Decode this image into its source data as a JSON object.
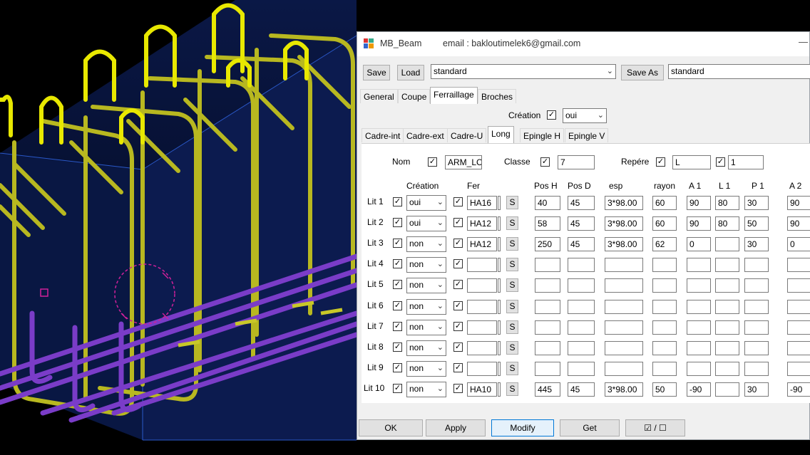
{
  "window": {
    "title": "MB_Beam",
    "email": "email :  bakloutimelek6@gmail.com",
    "minimize_glyph": "—"
  },
  "toolbar": {
    "save_label": "Save",
    "load_label": "Load",
    "preset_value": "standard",
    "save_as_label": "Save As",
    "save_as_value": "standard"
  },
  "main_tabs": [
    "General",
    "Coupe",
    "Ferraillage",
    "Broches"
  ],
  "creation": {
    "label": "Création",
    "checked": true,
    "value": "oui"
  },
  "sub_tabs": [
    "Cadre-int",
    "Cadre-ext",
    "Cadre-U",
    "Long",
    "Epingle H",
    "Epingle V"
  ],
  "header_fields": {
    "nom_label": "Nom",
    "nom_value": "ARM_LC",
    "classe_label": "Classe",
    "classe_value": "7",
    "repere_label": "Repére",
    "repere_value": "L",
    "repere2_value": "1"
  },
  "columns": {
    "creation": "Création",
    "fer": "Fer",
    "pos_h": "Pos H",
    "pos_d": "Pos D",
    "esp": "esp",
    "rayon": "rayon",
    "a1": "A 1",
    "l1": "L 1",
    "p1": "P 1",
    "a2": "A 2"
  },
  "rows": [
    {
      "label": "Lit 1",
      "creation": "oui",
      "fer": "HA16",
      "pos_h": "40",
      "pos_d": "45",
      "esp": "3*98.00",
      "rayon": "60",
      "a1": "90",
      "l1": "80",
      "p1": "30",
      "a2": "90"
    },
    {
      "label": "Lit 2",
      "creation": "oui",
      "fer": "HA12",
      "pos_h": "58",
      "pos_d": "45",
      "esp": "3*98.00",
      "rayon": "60",
      "a1": "90",
      "l1": "80",
      "p1": "50",
      "a2": "90"
    },
    {
      "label": "Lit 3",
      "creation": "non",
      "fer": "HA12",
      "pos_h": "250",
      "pos_d": "45",
      "esp": "3*98.00",
      "rayon": "62",
      "a1": "0",
      "l1": "",
      "p1": "30",
      "a2": "0"
    },
    {
      "label": "Lit 4",
      "creation": "non",
      "fer": "",
      "pos_h": "",
      "pos_d": "",
      "esp": "",
      "rayon": "",
      "a1": "",
      "l1": "",
      "p1": "",
      "a2": ""
    },
    {
      "label": "Lit 5",
      "creation": "non",
      "fer": "",
      "pos_h": "",
      "pos_d": "",
      "esp": "",
      "rayon": "",
      "a1": "",
      "l1": "",
      "p1": "",
      "a2": ""
    },
    {
      "label": "Lit 6",
      "creation": "non",
      "fer": "",
      "pos_h": "",
      "pos_d": "",
      "esp": "",
      "rayon": "",
      "a1": "",
      "l1": "",
      "p1": "",
      "a2": ""
    },
    {
      "label": "Lit 7",
      "creation": "non",
      "fer": "",
      "pos_h": "",
      "pos_d": "",
      "esp": "",
      "rayon": "",
      "a1": "",
      "l1": "",
      "p1": "",
      "a2": ""
    },
    {
      "label": "Lit 8",
      "creation": "non",
      "fer": "",
      "pos_h": "",
      "pos_d": "",
      "esp": "",
      "rayon": "",
      "a1": "",
      "l1": "",
      "p1": "",
      "a2": ""
    },
    {
      "label": "Lit 9",
      "creation": "non",
      "fer": "",
      "pos_h": "",
      "pos_d": "",
      "esp": "",
      "rayon": "",
      "a1": "",
      "l1": "",
      "p1": "",
      "a2": ""
    },
    {
      "label": "Lit 10",
      "creation": "non",
      "fer": "HA10",
      "pos_h": "445",
      "pos_d": "45",
      "esp": "3*98.00",
      "rayon": "50",
      "a1": "-90",
      "l1": "",
      "p1": "30",
      "a2": "-90"
    }
  ],
  "s_button_label": "S",
  "footer": {
    "ok": "OK",
    "apply": "Apply",
    "modify": "Modify",
    "get": "Get",
    "toggle": "☑ / ☐"
  },
  "colors": {
    "rebar_yellow": "#c8c828",
    "rebar_purple": "#7a3cc8",
    "concrete_blue": "#0b1a4a",
    "accent": "#0078d7"
  }
}
